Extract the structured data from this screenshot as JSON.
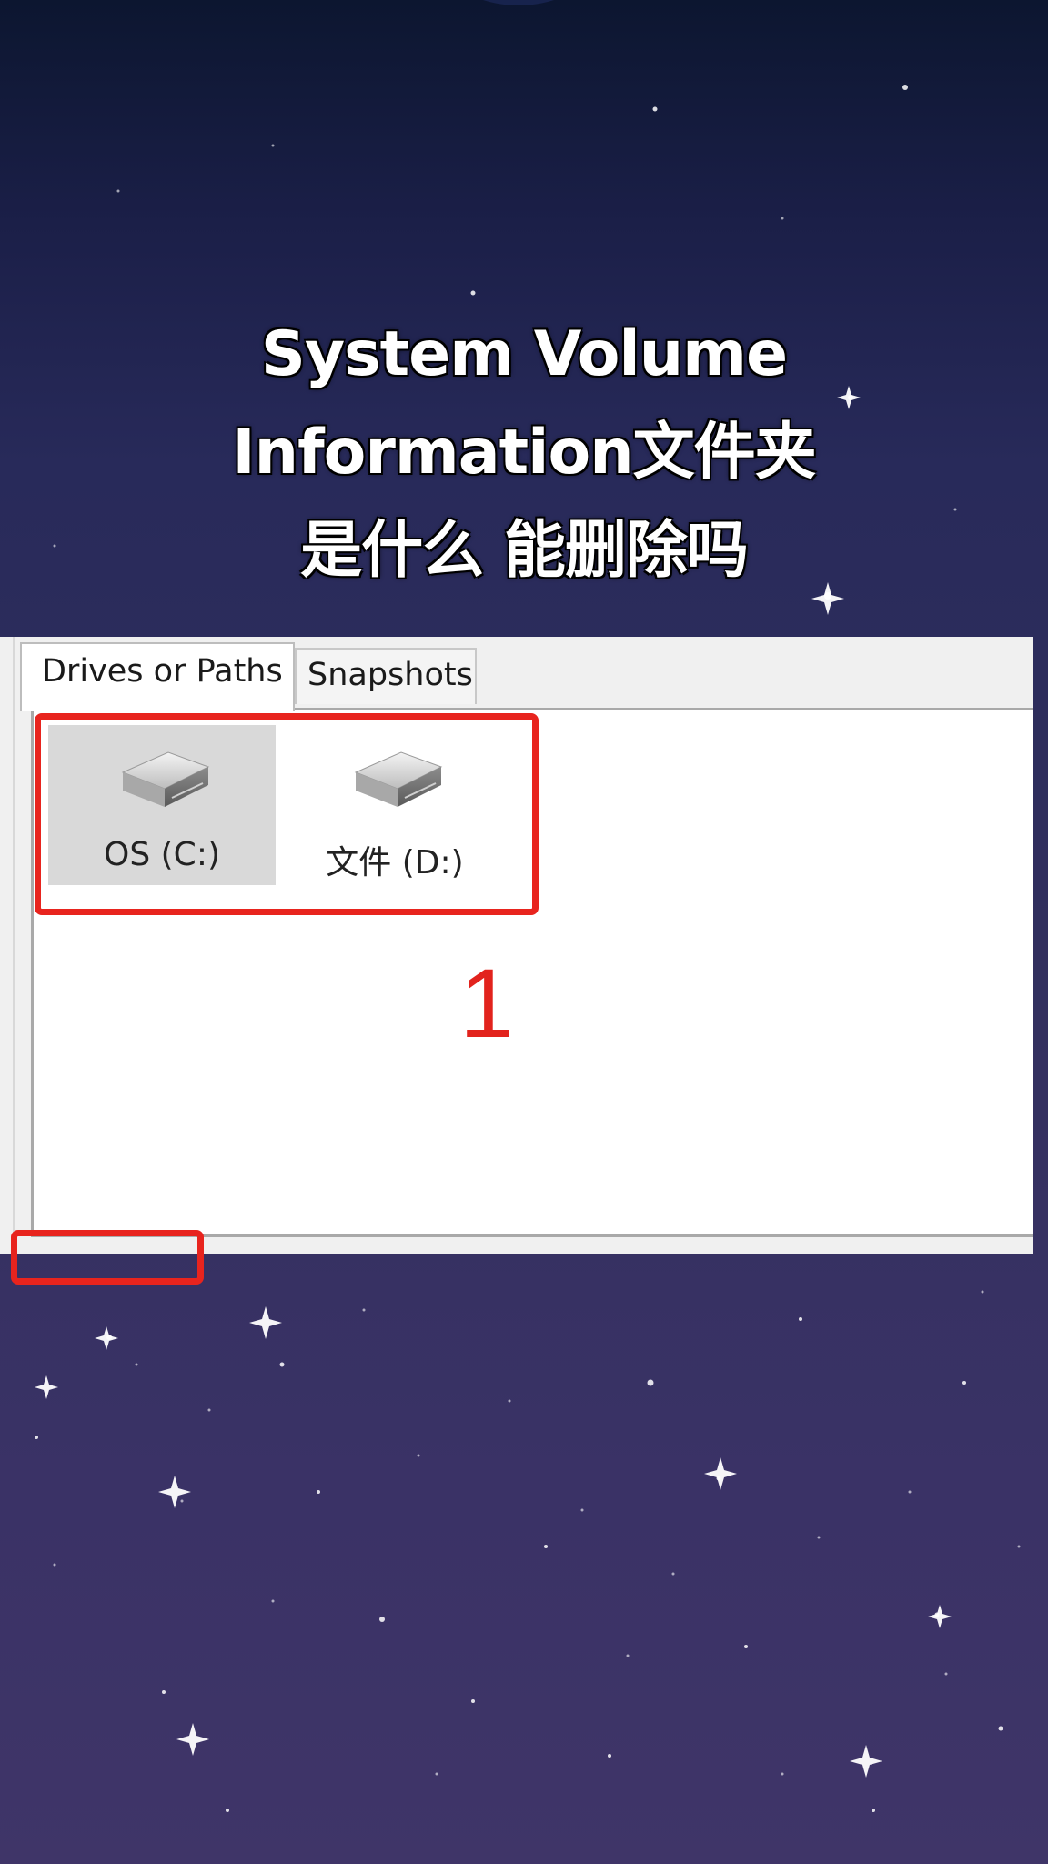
{
  "title": {
    "lines": [
      "System Volume",
      "Information文件夹",
      "是什么 能删除吗"
    ]
  },
  "tabs": [
    {
      "label": "Drives or Paths",
      "active": true
    },
    {
      "label": "Snapshots",
      "active": false
    }
  ],
  "drives": [
    {
      "label": "OS (C:)",
      "icon": "hard-drive-icon",
      "selected": true
    },
    {
      "label": "文件 (D:)",
      "icon": "hard-drive-icon",
      "selected": false
    }
  ],
  "annotation": {
    "step_number": "1",
    "color": "#e8241e"
  },
  "colors": {
    "background_top": "#0c1630",
    "background_bottom": "#3f3568",
    "title_text": "#ffffff"
  }
}
